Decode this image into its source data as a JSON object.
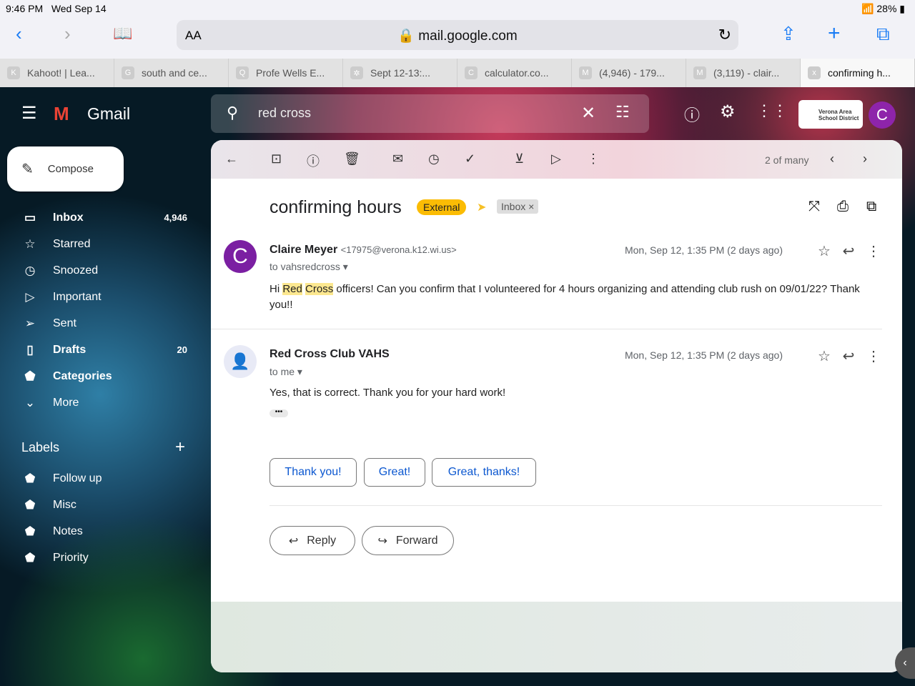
{
  "status": {
    "time": "9:46 PM",
    "date": "Wed Sep 14",
    "battery": "28%"
  },
  "browser": {
    "aa": "AA",
    "url": "mail.google.com"
  },
  "tabs": [
    {
      "icon": "K",
      "label": "Kahoot! | Lea..."
    },
    {
      "icon": "G",
      "label": "south and ce..."
    },
    {
      "icon": "Q",
      "label": "Profe Wells E..."
    },
    {
      "icon": "✲",
      "label": "Sept 12-13:..."
    },
    {
      "icon": "C",
      "label": "calculator.co..."
    },
    {
      "icon": "M",
      "label": "(4,946) - 179..."
    },
    {
      "icon": "M",
      "label": "(3,119) - clair..."
    },
    {
      "icon": "x",
      "label": "confirming h..."
    }
  ],
  "gmail": {
    "logo": "Gmail",
    "search": "red cross",
    "account_initial": "C",
    "org_logo": "Verona Area School District"
  },
  "compose": "Compose",
  "nav": [
    {
      "label": "Inbox",
      "count": "4,946",
      "icon": "▭"
    },
    {
      "label": "Starred",
      "count": "",
      "icon": "☆"
    },
    {
      "label": "Snoozed",
      "count": "",
      "icon": "◷"
    },
    {
      "label": "Important",
      "count": "",
      "icon": "▷"
    },
    {
      "label": "Sent",
      "count": "",
      "icon": "➢"
    },
    {
      "label": "Drafts",
      "count": "20",
      "icon": "▯"
    },
    {
      "label": "Categories",
      "count": "",
      "icon": "⬟"
    },
    {
      "label": "More",
      "count": "",
      "icon": "⌄"
    }
  ],
  "labels_title": "Labels",
  "labels": [
    "Follow up",
    "Misc",
    "Notes",
    "Priority"
  ],
  "pager": "2 of many",
  "thread": {
    "subject": "confirming hours",
    "external": "External",
    "inbox": "Inbox ×"
  },
  "messages": [
    {
      "initial": "C",
      "sender": "Claire Meyer",
      "email": "<17975@verona.k12.wi.us>",
      "to": "to vahsredcross ▾",
      "date": "Mon, Sep 12, 1:35 PM (2 days ago)",
      "pre": "Hi ",
      "h1": "Red",
      "h2": "Cross",
      "post": " officers! Can you confirm that I volunteered for 4 hours organizing and attending club rush on 09/01/22? Thank you!!"
    },
    {
      "sender": "Red Cross Club VAHS",
      "to": "to me ▾",
      "date": "Mon, Sep 12, 1:35 PM (2 days ago)",
      "body": "Yes, that is correct. Thank you for your hard work!"
    }
  ],
  "smart_replies": [
    "Thank you!",
    "Great!",
    "Great, thanks!"
  ],
  "reply": "Reply",
  "forward": "Forward"
}
